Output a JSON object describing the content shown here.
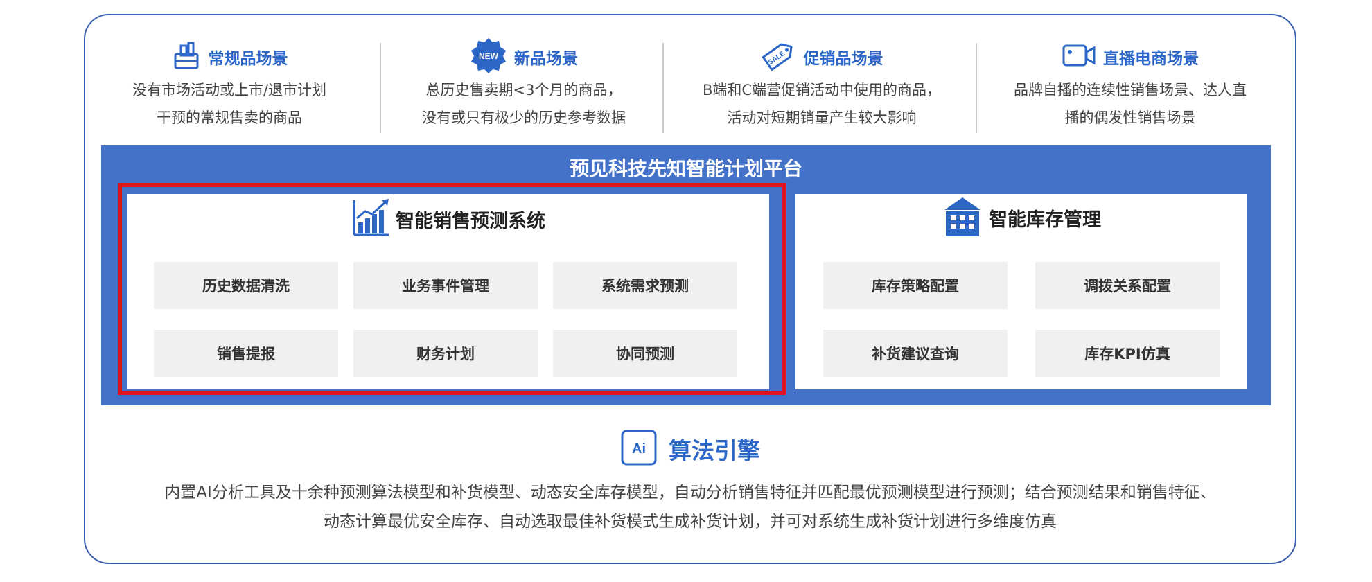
{
  "scenes": [
    {
      "title": "常规品场景",
      "line1": "没有市场活动或上市/退市计划",
      "line2": "干预的常规售卖的商品",
      "icon": "basket-icon"
    },
    {
      "title": "新品场景",
      "line1": "总历史售卖期<3个月的商品，",
      "line2": "没有或只有极少的历史参考数据",
      "icon": "new-badge-icon",
      "badge": "NEW"
    },
    {
      "title": "促销品场景",
      "line1": "B端和C端营促销活动中使用的商品，",
      "line2": "活动对短期销量产生较大影响",
      "icon": "sale-tag-icon",
      "badge": "SALE"
    },
    {
      "title": "直播电商场景",
      "line1": "品牌自播的连续性销售场景、达人直",
      "line2": "播的偶发性销售场景",
      "icon": "video-camera-icon"
    }
  ],
  "platform": {
    "title": "预见科技先知智能计划平台"
  },
  "sales_system": {
    "title": "智能销售预测系统",
    "icon": "bar-chart-icon",
    "modules": [
      "历史数据清洗",
      "业务事件管理",
      "系统需求预测",
      "销售提报",
      "财务计划",
      "协同预测"
    ]
  },
  "inventory_system": {
    "title": "智能库存管理",
    "icon": "warehouse-icon",
    "modules": [
      "库存策略配置",
      "调拨关系配置",
      "补货建议查询",
      "库存KPI仿真"
    ]
  },
  "engine": {
    "title": "算法引擎",
    "icon_text": "Ai",
    "line1": "内置AI分析工具及十余种预测算法模型和补货模型、动态安全库存模型，自动分析销售特征并匹配最优预测模型进行预测；结合预测结果和销售特征、",
    "line2": "动态计算最优安全库存、自动选取最佳补货模式生成补货计划，并可对系统生成补货计划进行多维度仿真"
  },
  "colors": {
    "accent": "#2c67c7",
    "platform_bg": "#4472c8",
    "highlight": "#e0141e",
    "module_bg": "#f0f0f0"
  }
}
